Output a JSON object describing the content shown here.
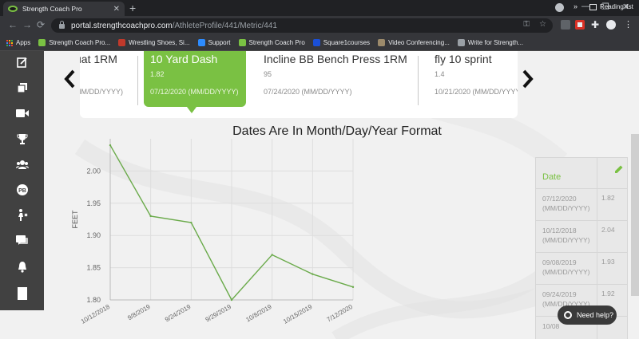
{
  "browser": {
    "tab_title": "Strength Coach Pro",
    "tab_close": "✕",
    "new_tab": "+",
    "controls": {
      "minimize": "—",
      "restore": "❐",
      "close": "✕"
    },
    "nav": {
      "back": "←",
      "forward": "→",
      "reload": "⟳"
    },
    "url_host": "portal.strengthcoachpro.com",
    "url_path": "/AthleteProfile/441/Metric/441",
    "omnibox_icons": [
      "key-icon",
      "star-icon"
    ],
    "bookmarks": [
      {
        "label": "Apps",
        "icon": "apps-grid-icon",
        "color": "#ea4335"
      },
      {
        "label": "Strength Coach Pro...",
        "icon": "scp-logo-icon",
        "color": "#7ac143"
      },
      {
        "label": "Wrestling Shoes, Si...",
        "icon": "shoe-icon",
        "color": "#c0392b"
      },
      {
        "label": "Support",
        "icon": "zoom-icon",
        "color": "#2d8cff"
      },
      {
        "label": "Strength Coach Pro",
        "icon": "scp-logo-icon",
        "color": "#7ac143"
      },
      {
        "label": "Square1courses",
        "icon": "c-logo-icon",
        "color": "#1a4fd6"
      },
      {
        "label": "Video Conferencing...",
        "icon": "video-icon",
        "color": "#9c8a6b"
      },
      {
        "label": "Write for Strength...",
        "icon": "doc-icon",
        "color": "#9aa0a6"
      }
    ],
    "bookmarks_more": "»",
    "reading_list": "Reading list"
  },
  "sidebar": {
    "items": [
      {
        "name": "notes-icon"
      },
      {
        "name": "copy-icon"
      },
      {
        "name": "video-icon"
      },
      {
        "name": "trophy-icon"
      },
      {
        "name": "group-icon"
      },
      {
        "name": "pb-icon",
        "label": "PB"
      },
      {
        "name": "athlete-icon"
      },
      {
        "name": "chat-icon"
      },
      {
        "name": "bell-icon"
      },
      {
        "name": "document-icon"
      }
    ]
  },
  "metrics": [
    {
      "name": "uat 1RM",
      "value": "",
      "date": "MM/DD/YYYY)",
      "active": false
    },
    {
      "name": "10 Yard Dash",
      "value": "1.82",
      "date": "07/12/2020 (MM/DD/YYYY)",
      "active": true
    },
    {
      "name": "Incline BB Bench Press 1RM",
      "value": "95",
      "date": "07/24/2020 (MM/DD/YYYY)",
      "active": false
    },
    {
      "name": "fly 10 sprint",
      "value": "1.4",
      "date": "10/21/2020 (MM/DD/YYYY)",
      "active": false
    }
  ],
  "chart_title": "Dates Are In Month/Day/Year Format",
  "chart_data": {
    "type": "line",
    "title": "Dates Are In Month/Day/Year Format",
    "xlabel": "",
    "ylabel": "FEET",
    "categories": [
      "10/12/2018",
      "9/8/2019",
      "9/24/2019",
      "9/29/2019",
      "10/8/2019",
      "10/15/2019",
      "7/12/2020"
    ],
    "series": [
      {
        "values": [
          2.04,
          1.93,
          1.92,
          1.8,
          1.87,
          1.84,
          1.82
        ]
      }
    ],
    "ylim": [
      1.8,
      2.05
    ],
    "yticks": [
      "2.00",
      "1.95",
      "1.90",
      "1.85",
      "1.80"
    ],
    "grid": true,
    "line_color": "#6aaa4a"
  },
  "history": {
    "header_date": "Date",
    "edit_icon": "pencil-icon",
    "rows": [
      {
        "date": "07/12/2020 (MM/DD/YYYY)",
        "value": "1.82"
      },
      {
        "date": "10/12/2018 (MM/DD/YYYY)",
        "value": "2.04"
      },
      {
        "date": "09/08/2019 (MM/DD/YYYY)",
        "value": "1.93"
      },
      {
        "date": "09/24/2019 (MM/DD/YYYY)",
        "value": "1.92"
      },
      {
        "date": "10/08",
        "value": ""
      }
    ]
  },
  "help_button": "Need help?",
  "colors": {
    "accent": "#7ac143",
    "sidebar": "#414141",
    "chrome_dark": "#202124",
    "chrome": "#35363a"
  }
}
